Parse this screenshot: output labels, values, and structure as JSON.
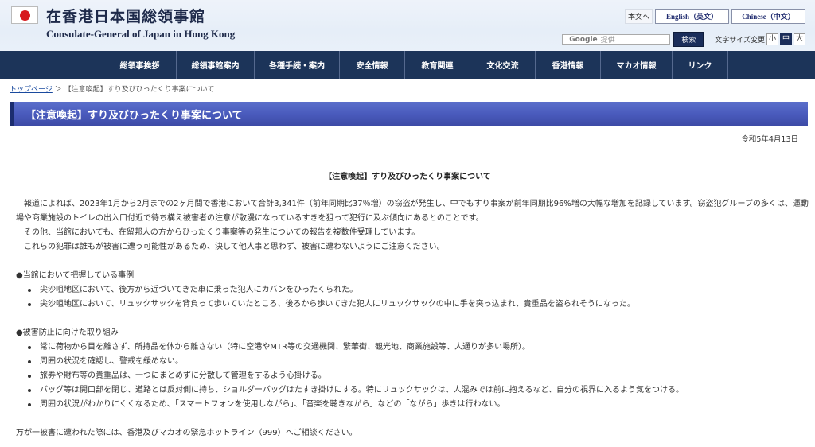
{
  "header": {
    "title": "在香港日本国総領事館",
    "subtitle": "Consulate-General of Japan in Hong Kong",
    "lang_japanese": "本文へ",
    "lang_english": "English（英文）",
    "lang_chinese": "Chinese（中文）",
    "search_brand": "Google",
    "search_placeholder": "提供",
    "search_button": "検索",
    "fontsize_label": "文字サイズ変更",
    "fontsize_small": "小",
    "fontsize_medium": "中",
    "fontsize_large": "大"
  },
  "nav": {
    "items": [
      {
        "label": "総領事挨拶"
      },
      {
        "label": "総領事館案内"
      },
      {
        "label": "各種手続・案内"
      },
      {
        "label": "安全情報"
      },
      {
        "label": "教育関連"
      },
      {
        "label": "文化交流"
      },
      {
        "label": "香港情報"
      },
      {
        "label": "マカオ情報"
      },
      {
        "label": "リンク"
      }
    ]
  },
  "breadcrumb": {
    "home": "トップページ",
    "separator": "＞",
    "current": "【注意喚起】すり及びひったくり事案について"
  },
  "page": {
    "title": "【注意喚起】すり及びひったくり事案について",
    "date": "令和5年4月13日",
    "center_title": "【注意喚起】すり及びひったくり事案について",
    "intro": [
      "報道によれば、2023年1月から2月までの2ヶ月間で香港において合計3,341件（前年同期比37％増）の窃盗が発生し、中でもすり事案が前年同期比96%増の大幅な増加を記録しています。窃盗犯グループの多くは、運動場や商業施設のトイレの出入口付近で待ち構え被害者の注意が散漫になっているすきを狙って犯行に及ぶ傾向にあるとのことです。",
      "その他、当館においても、在留邦人の方からひったくり事案等の発生についての報告を複数件受理しています。",
      "これらの犯罪は誰もが被害に遭う可能性があるため、決して他人事と思わず、被害に遭わないようにご注意ください。"
    ],
    "section1_heading": "●当館において把握している事例",
    "section1_items": [
      "尖沙咀地区において、後方から近づいてきた車に乗った犯人にカバンをひったくられた。",
      "尖沙咀地区において、リュックサックを背負って歩いていたところ、後ろから歩いてきた犯人にリュックサックの中に手を突っ込まれ、貴重品を盗られそうになった。"
    ],
    "section2_heading": "●被害防止に向けた取り組み",
    "section2_items": [
      "常に荷物から目を離さず、所持品を体から離さない（特に空港やMTR等の交通機関、繁華街、観光地、商業施設等、人通りが多い場所）。",
      "周囲の状況を確認し、警戒を緩めない。",
      "旅券や財布等の貴重品は、一つにまとめずに分散して管理をするよう心掛ける。",
      "バッグ等は開口部を閉じ、道路とは反対側に持ち、ショルダーバッグはたすき掛けにする。特にリュックサックは、人混みでは前に抱えるなど、自分の視界に入るよう気をつける。",
      "周囲の状況がわかりにくくなるため、「スマートフォンを使用しながら」、「音楽を聴きながら」などの「ながら」歩きは行わない。"
    ],
    "closing": "万が一被害に遭われた際には、香港及びマカオの緊急ホットライン（999）へご相談ください。"
  },
  "colors": {
    "nav_bg": "#1c3459",
    "title_bar": "#4a5bbd",
    "flag_red": "#d7191e"
  }
}
